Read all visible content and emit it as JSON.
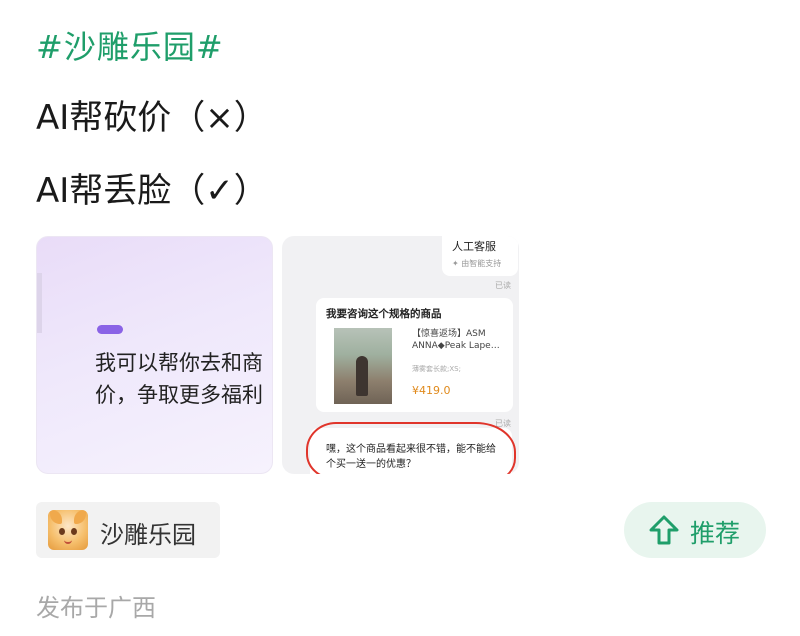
{
  "post": {
    "hashtag": "#沙雕乐园#",
    "line1": "AI帮砍价（×）",
    "line2": "AI帮丢脸（✓）"
  },
  "images": {
    "first": {
      "text_line1": "我可以帮你去和商",
      "text_line2": "价，争取更多福利"
    },
    "second": {
      "service_title": "人工客服",
      "service_sub": "✦ 由智能支持",
      "read_label": "已读",
      "card_title": "我要咨询这个规格的商品",
      "product_name": "【惊喜返场】ASM ANNA◆Peak Lape…",
      "product_spec": "薄雾套长款;XS;",
      "product_price": "¥419.0",
      "message": "嘿，这个商品看起来很不错，能不能给个买一送一的优惠？"
    }
  },
  "topic": {
    "label": "沙雕乐园",
    "avatar_icon": "cartoon-cat-avatar"
  },
  "recommend": {
    "label": "推荐",
    "icon": "arrow-up-outline-icon",
    "color": "#1f9e6a"
  },
  "location": "发布于广西",
  "colors": {
    "accent": "#1f9e6a",
    "accent_bg": "#e8f5ee",
    "annotation_red": "#e0352b",
    "price_orange": "#e08a1c"
  }
}
